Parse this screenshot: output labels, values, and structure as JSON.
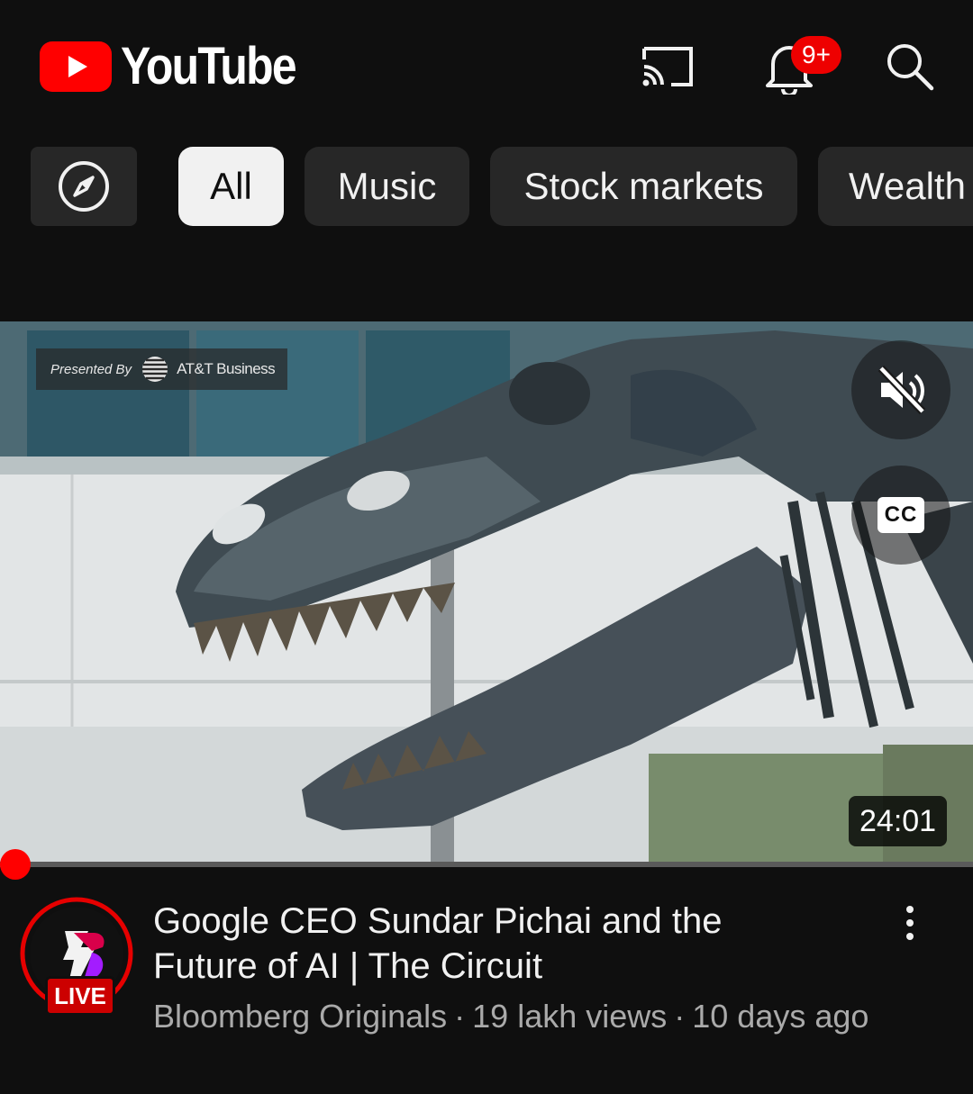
{
  "header": {
    "logo_text": "YouTube",
    "notification_count": "9+"
  },
  "chips": [
    {
      "label": "All",
      "active": true
    },
    {
      "label": "Music",
      "active": false
    },
    {
      "label": "Stock markets",
      "active": false
    },
    {
      "label": "Wealth",
      "active": false
    }
  ],
  "video": {
    "sponsor_prefix": "Presented By",
    "sponsor_brand": "AT&T Business",
    "cc_label": "CC",
    "duration": "24:01",
    "progress_fraction": 0.0
  },
  "details": {
    "live_label": "LIVE",
    "title": "Google CEO Sundar Pichai and the Future of AI | The Circuit",
    "channel": "Bloomberg Originals",
    "views": "19 lakh views",
    "age": "10 days ago",
    "separator": "·"
  },
  "colors": {
    "accent": "#ff0000",
    "background": "#0f0f0f",
    "chip": "#272727",
    "secondary_text": "#aaaaaa"
  },
  "icons": [
    "youtube-logo",
    "cast-icon",
    "bell-icon",
    "search-icon",
    "compass-icon",
    "mute-icon",
    "cc-icon",
    "more-vert-icon"
  ]
}
